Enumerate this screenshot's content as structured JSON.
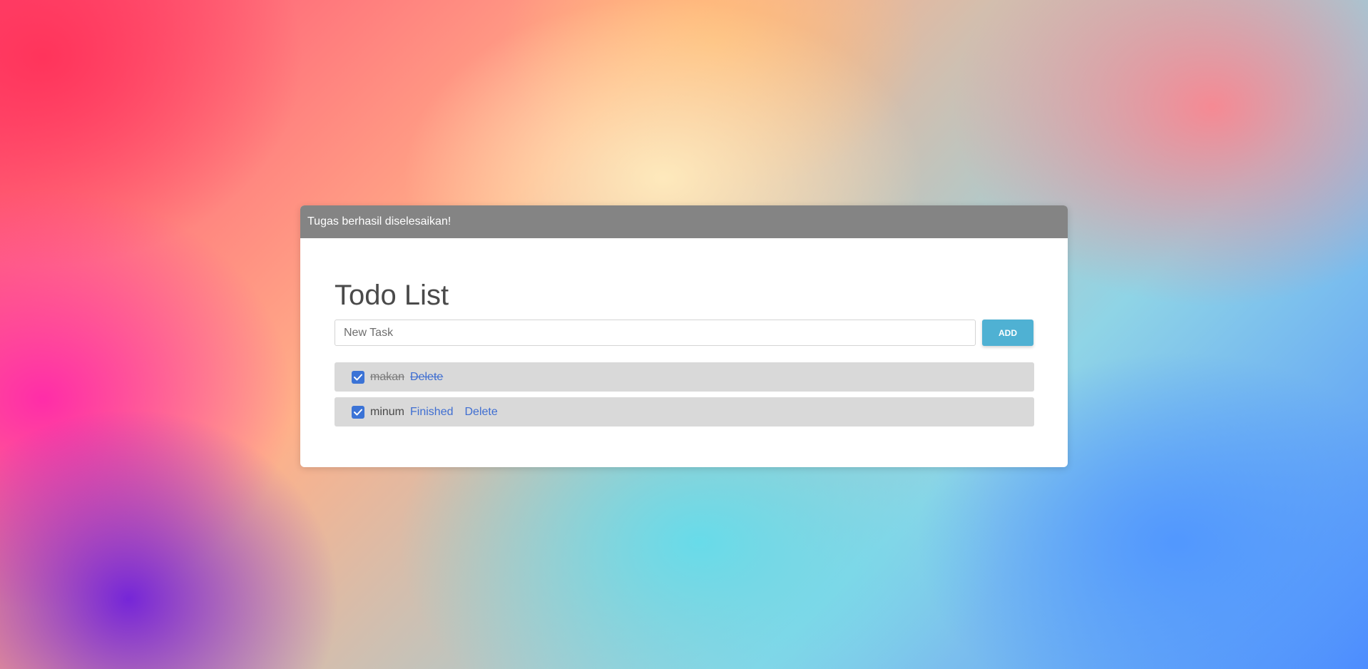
{
  "alert": {
    "message": "Tugas berhasil diselesaikan!"
  },
  "title": "Todo List",
  "input": {
    "placeholder": "New Task",
    "value": ""
  },
  "add_button": {
    "label": "ADD"
  },
  "tasks": [
    {
      "label": "makan",
      "completed": true,
      "delete_label": "Delete"
    },
    {
      "label": "minum",
      "completed": true,
      "finished_label": "Finished",
      "delete_label": "Delete"
    }
  ],
  "colors": {
    "alert_bg": "#848484",
    "add_button_bg": "#4fb1d3",
    "checkbox": "#3b73d6",
    "link": "#3f6ed1",
    "item_bg": "#d9d9d9"
  },
  "icons": {
    "checkbox": "checkmark-icon"
  }
}
